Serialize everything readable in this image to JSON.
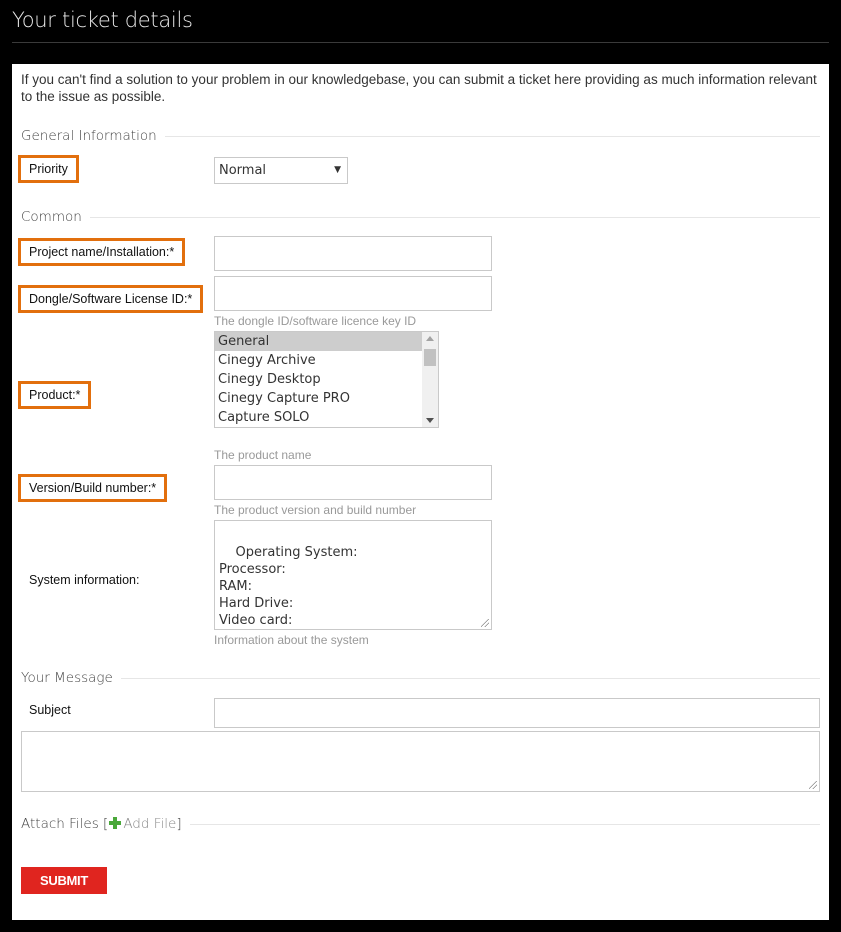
{
  "header": {
    "title": "Your ticket details"
  },
  "intro": "If you can't find a solution to your problem in our knowledgebase, you can submit a ticket here providing as much information relevant to the issue as possible.",
  "sections": {
    "general": "General Information",
    "common": "Common",
    "message": "Your Message"
  },
  "fields": {
    "priority": {
      "label": "Priority",
      "value": "Normal"
    },
    "project": {
      "label": "Project name/Installation:*",
      "value": ""
    },
    "dongle": {
      "label": "Dongle/Software License ID:*",
      "value": "",
      "hint": "The dongle ID/software licence key ID"
    },
    "product": {
      "label": "Product:*",
      "options": [
        "General",
        "Cinegy Archive",
        "Cinegy Desktop",
        "Cinegy Capture PRO",
        "Capture SOLO"
      ],
      "selected": "General",
      "hint": "The product name"
    },
    "version": {
      "label": "Version/Build number:*",
      "value": "",
      "hint": "The product version and build number"
    },
    "system": {
      "label": "System information:",
      "value": "Operating System:\nProcessor:\nRAM:\nHard Drive:\nVideo card:",
      "hint": "Information about the system"
    },
    "subject": {
      "label": "Subject",
      "value": ""
    },
    "message": {
      "value": ""
    }
  },
  "attach": {
    "label": "Attach Files [",
    "add_label": "Add File",
    "close": "]"
  },
  "submit_label": "SUBMIT",
  "colors": {
    "highlight": "#e26f0d",
    "submit": "#e0251f",
    "add_icon": "#4aa83a"
  }
}
